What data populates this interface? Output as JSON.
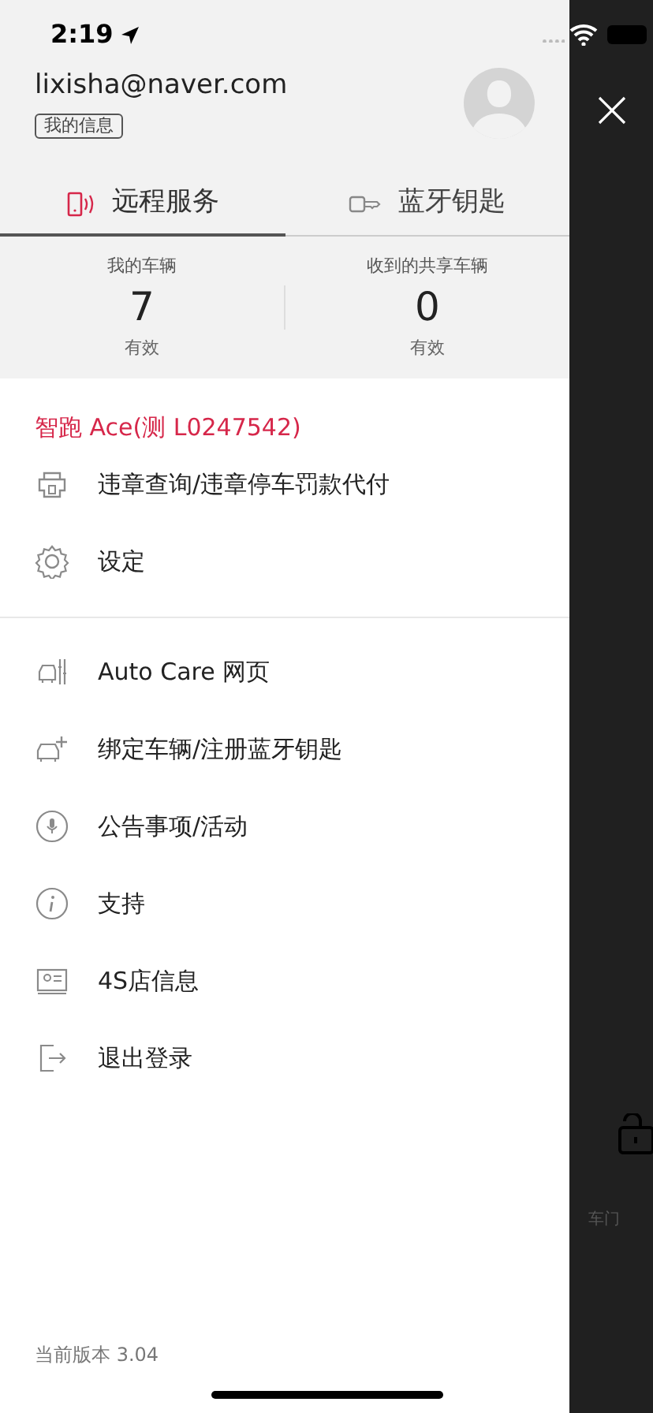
{
  "status_bar": {
    "time": "2:19"
  },
  "account": {
    "email": "lixisha@naver.com",
    "profile_button": "我的信息"
  },
  "tabs": [
    {
      "label": "远程服务",
      "selected": true
    },
    {
      "label": "蓝牙钥匙",
      "selected": false
    }
  ],
  "stats": [
    {
      "label": "我的车辆",
      "value": "7",
      "note": "有效"
    },
    {
      "label": "收到的共享车辆",
      "value": "0",
      "note": "有效"
    }
  ],
  "vehicle_name": "智跑 Ace(测 L0247542)",
  "menu_groups": [
    [
      {
        "label": "违章查询/违章停车罚款代付"
      },
      {
        "label": "设定"
      }
    ],
    [
      {
        "label": "Auto Care 网页"
      },
      {
        "label": "绑定车辆/注册蓝牙钥匙"
      },
      {
        "label": "公告事项/活动"
      },
      {
        "label": "支持"
      },
      {
        "label": "4S店信息"
      },
      {
        "label": "退出登录"
      }
    ]
  ],
  "version": "当前版本 3.04",
  "background": {
    "door_label": "车门"
  }
}
